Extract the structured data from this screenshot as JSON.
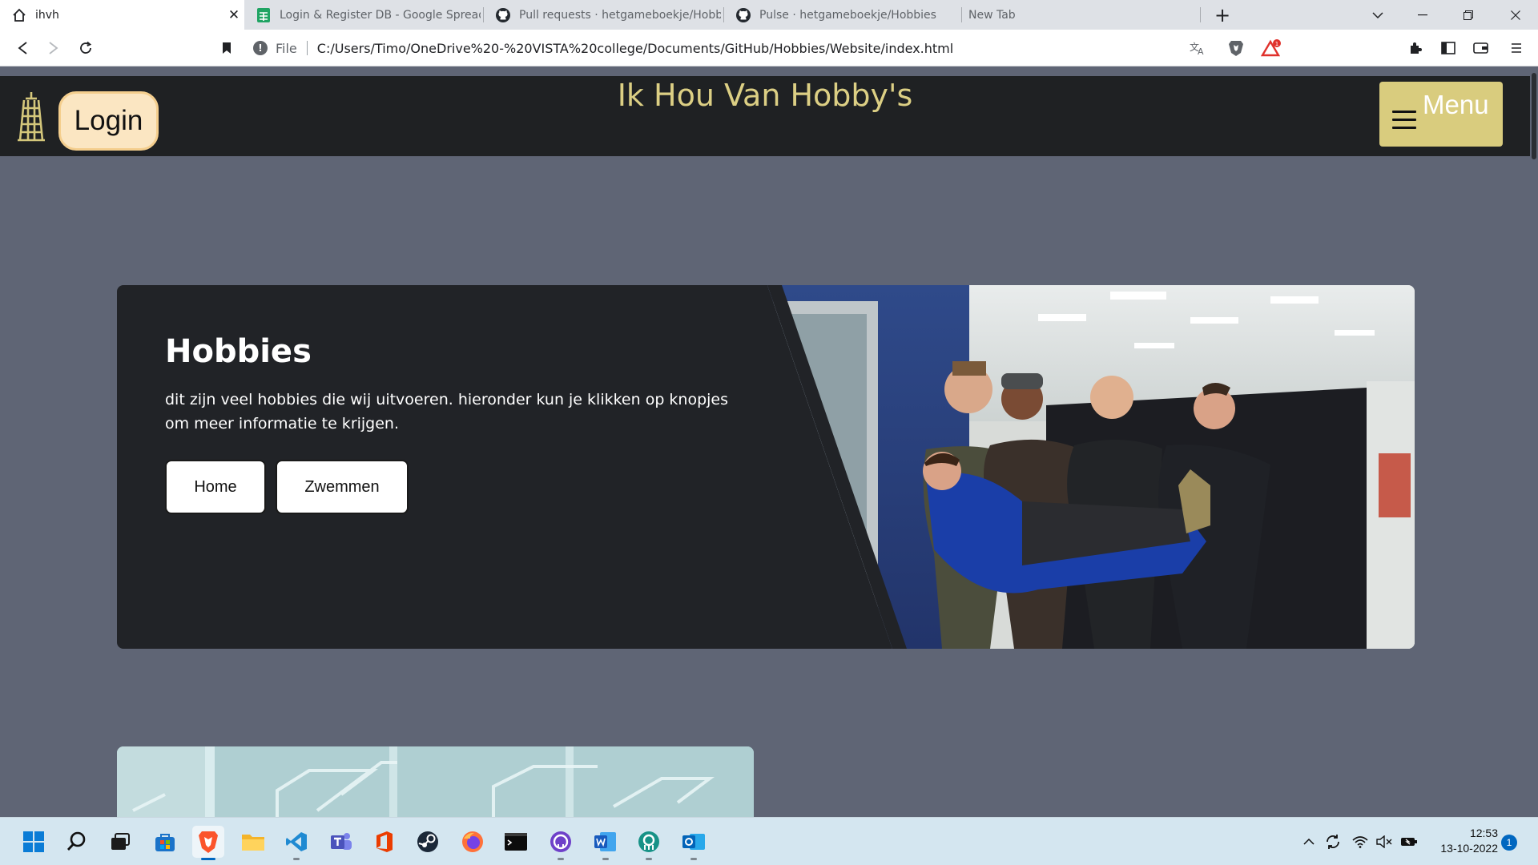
{
  "browser": {
    "tabs": [
      {
        "title": "ihvh",
        "icon": "home-icon",
        "active": true
      },
      {
        "title": "Login & Register DB - Google Spreads",
        "icon": "google-sheets-icon"
      },
      {
        "title": "Pull requests · hetgameboekje/Hobbie",
        "icon": "github-icon"
      },
      {
        "title": "Pulse · hetgameboekje/Hobbies",
        "icon": "github-icon"
      },
      {
        "title": "New Tab",
        "icon": ""
      }
    ],
    "new_tab_symbol": "+",
    "url_scheme": "File",
    "url": "C:/Users/Timo/OneDrive%20-%20VISTA%20college/Documents/GitHub/Hobbies/Website/index.html",
    "brave_alert_count": "1"
  },
  "site": {
    "login_label": "Login",
    "title": "Ik Hou Van Hobby's",
    "menu_label": "Menu",
    "hero": {
      "heading": "Hobbies",
      "text": "dit zijn veel hobbies die wij uitvoeren. hieronder kun je klikken op knopjes om meer informatie te krijgen.",
      "buttons": [
        "Home",
        "Zwemmen"
      ]
    }
  },
  "taskbar": {
    "apps": [
      "windows-start-icon",
      "search-icon",
      "task-view-icon",
      "microsoft-store-icon",
      "brave-browser-icon",
      "file-explorer-icon",
      "vscode-icon",
      "teams-icon",
      "office-icon",
      "steam-icon",
      "firefox-icon",
      "terminal-icon",
      "github-desktop-icon",
      "word-icon",
      "gitkraken-icon",
      "outlook-icon"
    ],
    "time": "12:53",
    "date": "13-10-2022",
    "notification_count": "1"
  },
  "colors": {
    "page_bg": "#5f6575",
    "header_bg": "#1f2123",
    "title_color": "#dccf84",
    "menu_bg": "#d9cc7e",
    "login_bg": "#fbe6c2",
    "hero_bg": "#212327"
  }
}
